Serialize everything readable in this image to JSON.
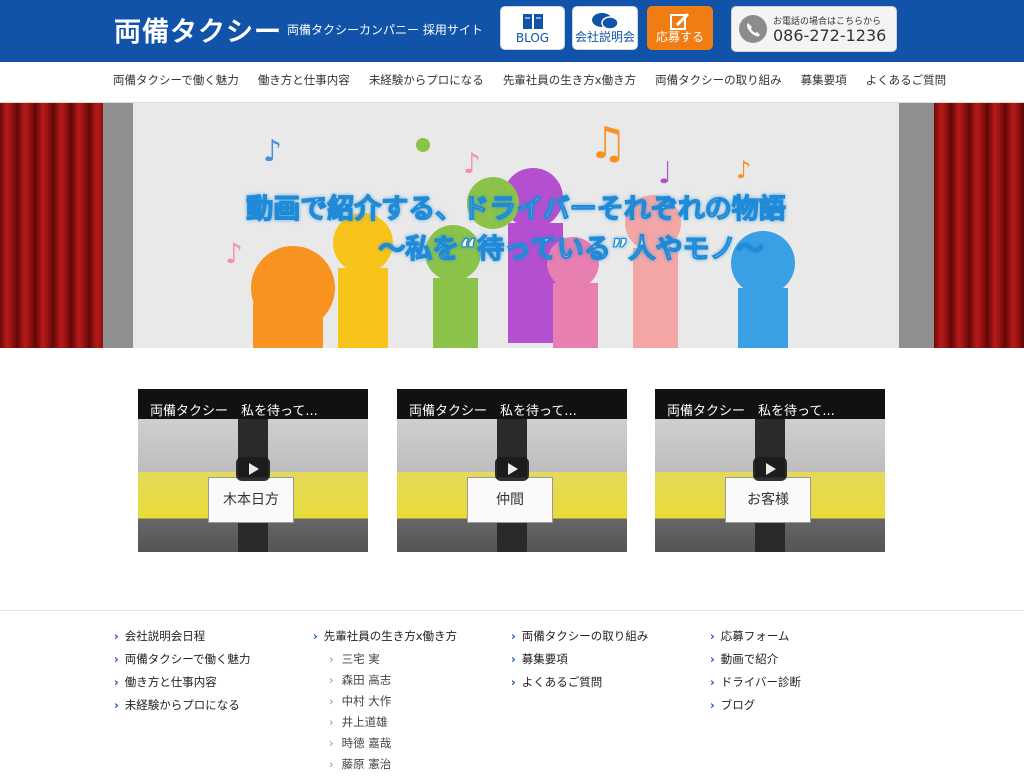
{
  "header": {
    "logo": "両備タクシー",
    "tagline": "両備タクシーカンパニー 採用サイト",
    "buttons": [
      {
        "label": "BLOG",
        "icon": "book-icon"
      },
      {
        "label": "会社説明会",
        "icon": "speech-bubble-icon"
      },
      {
        "label": "応募する",
        "icon": "pencil-icon"
      }
    ],
    "phone_note": "お電話の場合はこちらから",
    "phone_number": "086-272-1236",
    "colors": {
      "header_bg": "#1153a8",
      "apply_bg": "#f07d13"
    }
  },
  "nav": {
    "items": [
      "両備タクシーで働く魅力",
      "働き方と仕事内容",
      "未経験からプロになる",
      "先輩社員の生き方x働き方",
      "両備タクシーの取り組み",
      "募集要項",
      "よくあるご質問"
    ]
  },
  "hero": {
    "title": "動画で紹介する、ドライバーそれぞれの物語",
    "subtitle": "～私を“待っている”人やモノ～"
  },
  "videos": [
    {
      "title": "両備タクシー　私を待って...",
      "sign": "木本日方"
    },
    {
      "title": "両備タクシー　私を待って...",
      "sign": "仲間"
    },
    {
      "title": "両備タクシー　私を待って...",
      "sign": "お客様"
    }
  ],
  "footer": {
    "col1": [
      "会社説明会日程",
      "両備タクシーで働く魅力",
      "働き方と仕事内容",
      "未経験からプロになる"
    ],
    "col2": {
      "heading": "先輩社員の生き方x働き方",
      "subitems": [
        "三宅 実",
        "森田 高志",
        "中村 大作",
        "井上道雄",
        "時徳 嘉哉",
        "藤原 憲治"
      ]
    },
    "col3": [
      "両備タクシーの取り組み",
      "募集要項",
      "よくあるご質問"
    ],
    "col4": [
      "応募フォーム",
      "動画で紹介",
      "ドライバー診断",
      "ブログ"
    ]
  }
}
